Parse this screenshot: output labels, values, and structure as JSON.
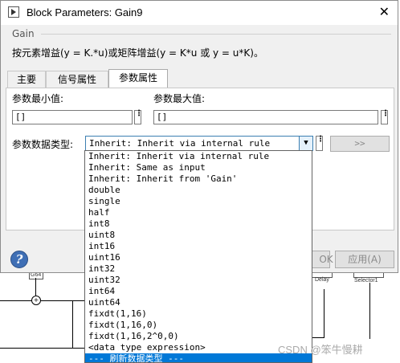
{
  "window": {
    "title": "Block Parameters: Gain9",
    "close_glyph": "✕"
  },
  "group_label": "Gain",
  "description": "按元素增益(y = K.*u)或矩阵增益(y = K*u 或 y = u*K)。",
  "tabs": [
    {
      "label": "主要",
      "active": false
    },
    {
      "label": "信号属性",
      "active": false
    },
    {
      "label": "参数属性",
      "active": true
    }
  ],
  "fields": {
    "param_min_label": "参数最小值:",
    "param_min_value": "[]",
    "param_max_label": "参数最大值:",
    "param_max_value": "[]",
    "data_type_label": "参数数据类型:",
    "data_type_value": "Inherit: Inherit via internal rule",
    "assistant_button": ">>"
  },
  "dropdown_options": [
    "Inherit: Inherit via internal rule",
    "Inherit: Same as input",
    "Inherit: Inherit from 'Gain'",
    "double",
    "single",
    "half",
    "int8",
    "uint8",
    "int16",
    "uint16",
    "int32",
    "uint32",
    "int64",
    "uint64",
    "fixdt(1,16)",
    "fixdt(1,16,0)",
    "fixdt(1,16,2^0,0)",
    "<data type expression>",
    "--- 刷新数据类型 ---"
  ],
  "selected_option_index": 18,
  "buttons": {
    "ok_partial": "OK",
    "apply": "应用(A)"
  },
  "background_labels": {
    "gain_block": "G64",
    "delay": "Delay",
    "selector": "Selector1"
  },
  "watermark": "CSDN @笨牛慢耕",
  "colors": {
    "selected_bg": "#0078d7",
    "select_border": "#3c7fb1",
    "help_blue": "#3f6fb5"
  }
}
